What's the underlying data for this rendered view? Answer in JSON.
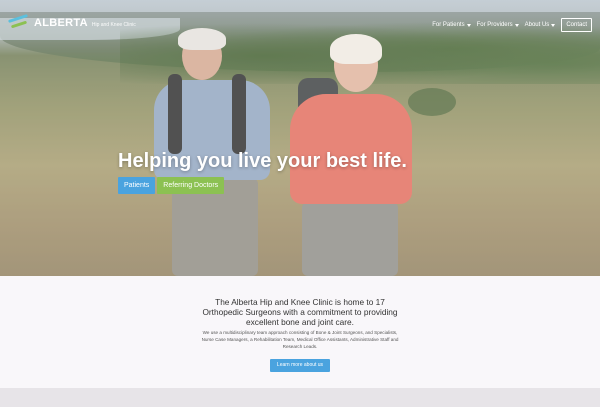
{
  "brand": {
    "name": "ALBERTA",
    "sub": "Hip and Knee Clinic"
  },
  "nav": {
    "items": [
      {
        "label": "For Patients"
      },
      {
        "label": "For Providers"
      },
      {
        "label": "About Us"
      }
    ],
    "contact": "Contact"
  },
  "hero": {
    "headline": "Helping you live your best life.",
    "buttons": [
      {
        "label": "Patients",
        "color": "#4aa3df"
      },
      {
        "label": "Referring Doctors",
        "color": "#8cc152"
      }
    ]
  },
  "intro": {
    "title": "The Alberta Hip and Knee Clinic is home to 17 Orthopedic Surgeons with a commitment to providing excellent bone and joint care.",
    "body": "We use a multidisciplinary team approach consisting of Bone & Joint Surgeons, and Specialists, Nurse Case Managers, a Rehabilitation Team, Medical Office Assistants, Administrative Staff and Research Leads.",
    "button": "Learn more about us"
  },
  "colors": {
    "accent_blue": "#4aa3df",
    "accent_green": "#8cc152"
  },
  "icons": {
    "logo": "brand-swoosh-icon",
    "dropdown": "caret-down-icon"
  }
}
